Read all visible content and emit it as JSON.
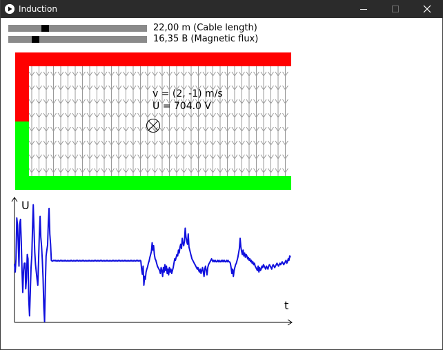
{
  "window": {
    "title": "Induction",
    "icon": "play-icon"
  },
  "controls": {
    "cable_length": {
      "label": "22,00 m (Cable length)",
      "level": 0.25
    },
    "magnetic_flux": {
      "label": "16,35 B (Magnetic flux)",
      "level": 0.18
    }
  },
  "simulation": {
    "velocity_text": "v = (2, -1) m/s",
    "voltage_text": "U = 704.0 V",
    "field_symbol": "field-into-page-icon",
    "colors": {
      "rail_red": "#ff0000",
      "rail_green": "#00ff00",
      "field_arrows": "#9a9a9a"
    }
  },
  "chart_data": {
    "type": "line",
    "xlabel": "t",
    "ylabel": "U",
    "color": "#1010dd",
    "values": [
      -1,
      -12,
      6,
      62,
      52,
      28,
      -4,
      54,
      60,
      30,
      -10,
      -40,
      -10,
      0,
      0,
      -35,
      -20,
      12,
      6,
      -50,
      -72,
      -40,
      -6,
      10,
      50,
      80,
      46,
      15,
      -2,
      -12,
      -22,
      -30,
      3,
      40,
      64,
      36,
      24,
      5,
      -20,
      -60,
      -80,
      -30,
      10,
      18,
      25,
      55,
      75,
      40,
      26,
      4,
      3,
      3,
      4,
      4,
      3,
      4,
      3,
      3,
      4,
      3,
      3,
      4,
      3,
      4,
      3,
      3,
      4,
      3,
      4,
      3,
      3,
      4,
      3,
      3,
      4,
      3,
      4,
      3,
      3,
      4,
      3,
      3,
      4,
      3,
      4,
      3,
      3,
      4,
      3,
      3,
      4,
      3,
      4,
      3,
      3,
      4,
      3,
      3,
      4,
      3,
      4,
      3,
      3,
      4,
      3,
      3,
      4,
      3,
      4,
      3,
      3,
      4,
      3,
      3,
      4,
      3,
      4,
      3,
      3,
      4,
      3,
      3,
      4,
      3,
      4,
      3,
      3,
      4,
      3,
      3,
      4,
      3,
      4,
      3,
      3,
      4,
      3,
      3,
      4,
      3,
      4,
      3,
      3,
      4,
      3,
      3,
      4,
      3,
      4,
      3,
      3,
      4,
      3,
      3,
      4,
      3,
      4,
      3,
      3,
      4,
      3,
      3,
      4,
      3,
      4,
      3,
      3,
      4,
      3,
      -8,
      -15,
      -4,
      -30,
      -18,
      -22,
      -12,
      -8,
      -5,
      0,
      3,
      8,
      12,
      16,
      28,
      18,
      24,
      12,
      6,
      4,
      0,
      -4,
      -6,
      -8,
      -10,
      -14,
      -6,
      -10,
      -18,
      -6,
      -12,
      -2,
      -10,
      -4,
      -14,
      -8,
      -16,
      -6,
      -12,
      -8,
      -14,
      -10,
      -6,
      0,
      6,
      4,
      8,
      12,
      10,
      18,
      14,
      22,
      26,
      20,
      34,
      28,
      24,
      30,
      48,
      36,
      30,
      26,
      40,
      22,
      18,
      14,
      10,
      6,
      4,
      2,
      0,
      -2,
      -4,
      -6,
      -8,
      -6,
      -10,
      -12,
      -8,
      -14,
      -10,
      -6,
      -12,
      -18,
      -8,
      -4,
      -10,
      -16,
      -6,
      -2,
      0,
      2,
      4,
      6,
      4,
      2,
      4,
      2,
      4,
      2,
      2,
      4,
      2,
      4,
      2,
      2,
      4,
      2,
      4,
      2,
      4,
      2,
      2,
      4,
      2,
      4,
      2,
      2,
      0,
      -6,
      -14,
      -8,
      -18,
      -10,
      -6,
      -2,
      0,
      4,
      8,
      14,
      20,
      34,
      22,
      16,
      12,
      18,
      10,
      14,
      8,
      12,
      10,
      6,
      8,
      4,
      6,
      2,
      4,
      0,
      2,
      -2,
      0,
      -4,
      -6,
      -8,
      -10,
      -4,
      -12,
      -6,
      -10,
      -8,
      -4,
      -6,
      -2,
      -4,
      -6,
      -8,
      -4,
      -6,
      -8,
      -4,
      -2,
      -4,
      -6,
      -8,
      -4,
      -2,
      -4,
      -6,
      -4,
      -2,
      0,
      -2,
      -4,
      -2,
      0,
      -2,
      0,
      2,
      0,
      -2,
      0,
      2,
      4,
      0,
      2,
      6,
      4,
      10,
      8
    ],
    "ylim": [
      -80,
      90
    ]
  }
}
